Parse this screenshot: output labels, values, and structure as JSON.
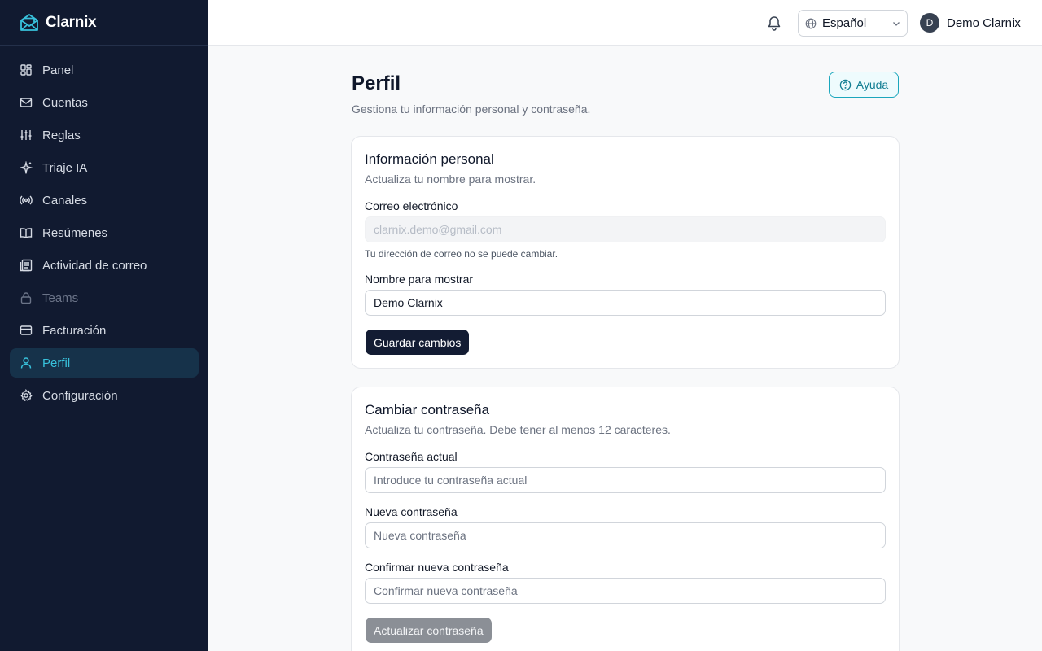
{
  "app": {
    "name": "Clarnix"
  },
  "sidebar": {
    "items": [
      {
        "label": "Panel"
      },
      {
        "label": "Cuentas"
      },
      {
        "label": "Reglas"
      },
      {
        "label": "Triaje IA"
      },
      {
        "label": "Canales"
      },
      {
        "label": "Resúmenes"
      },
      {
        "label": "Actividad de correo"
      },
      {
        "label": "Teams"
      },
      {
        "label": "Facturación"
      },
      {
        "label": "Perfil"
      },
      {
        "label": "Configuración"
      }
    ]
  },
  "topbar": {
    "language": "Español",
    "user_initial": "D",
    "user_name": "Demo Clarnix"
  },
  "page": {
    "title": "Perfil",
    "subtitle": "Gestiona tu información personal y contraseña.",
    "help_label": "Ayuda"
  },
  "personal": {
    "title": "Información personal",
    "description": "Actualiza tu nombre para mostrar.",
    "email_label": "Correo electrónico",
    "email_value": "clarnix.demo@gmail.com",
    "email_hint": "Tu dirección de correo no se puede cambiar.",
    "name_label": "Nombre para mostrar",
    "name_value": "Demo Clarnix",
    "save_label": "Guardar cambios"
  },
  "password": {
    "title": "Cambiar contraseña",
    "description": "Actualiza tu contraseña. Debe tener al menos 12 caracteres.",
    "current_label": "Contraseña actual",
    "current_placeholder": "Introduce tu contraseña actual",
    "new_label": "Nueva contraseña",
    "new_placeholder": "Nueva contraseña",
    "confirm_label": "Confirmar nueva contraseña",
    "confirm_placeholder": "Confirmar nueva contraseña",
    "update_label": "Actualizar contraseña"
  },
  "colors": {
    "sidebar_bg": "#111a30",
    "accent": "#38c2dc",
    "primary_button": "#131c33"
  }
}
